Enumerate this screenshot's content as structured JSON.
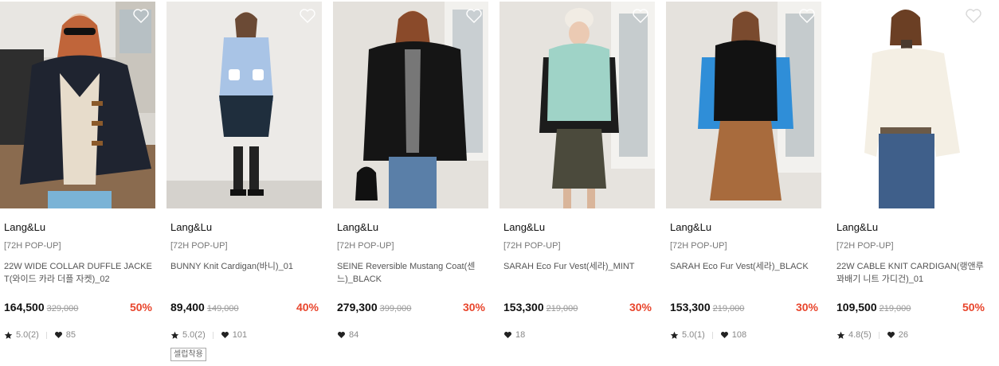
{
  "products": [
    {
      "brand": "Lang&Lu",
      "tag": "[72H POP-UP]",
      "name": "22W WIDE COLLAR DUFFLE JACKET(와이드 카라 더플 자켓)_02",
      "price": "164,500",
      "original_price": "329,000",
      "discount": "50%",
      "rating": "5.0(2)",
      "likes": "85",
      "badge": ""
    },
    {
      "brand": "Lang&Lu",
      "tag": "[72H POP-UP]",
      "name": "BUNNY Knit Cardigan(바니)_01",
      "price": "89,400",
      "original_price": "149,000",
      "discount": "40%",
      "rating": "5.0(2)",
      "likes": "101",
      "badge": "셀럽착용"
    },
    {
      "brand": "Lang&Lu",
      "tag": "[72H POP-UP]",
      "name": "SEINE Reversible Mustang Coat(센느)_BLACK",
      "price": "279,300",
      "original_price": "399,000",
      "discount": "30%",
      "rating": "",
      "likes": "84",
      "badge": ""
    },
    {
      "brand": "Lang&Lu",
      "tag": "[72H POP-UP]",
      "name": "SARAH Eco Fur Vest(세라)_MINT",
      "price": "153,300",
      "original_price": "219,000",
      "discount": "30%",
      "rating": "",
      "likes": "18",
      "badge": ""
    },
    {
      "brand": "Lang&Lu",
      "tag": "[72H POP-UP]",
      "name": "SARAH Eco Fur Vest(세라)_BLACK",
      "price": "153,300",
      "original_price": "219,000",
      "discount": "30%",
      "rating": "5.0(1)",
      "likes": "108",
      "badge": ""
    },
    {
      "brand": "Lang&Lu",
      "tag": "[72H POP-UP]",
      "name": "22W CABLE KNIT CARDIGAN(랭앤루 꽈배기 니트 가디건)_01",
      "price": "109,500",
      "original_price": "219,000",
      "discount": "50%",
      "rating": "4.8(5)",
      "likes": "26",
      "badge": ""
    }
  ],
  "icons": {
    "wishlist": "heart-outline-icon",
    "rating": "star-icon",
    "likes": "heart-filled-icon"
  },
  "colors": {
    "discount": "#e8452c",
    "price": "#111111",
    "muted": "#888888"
  }
}
